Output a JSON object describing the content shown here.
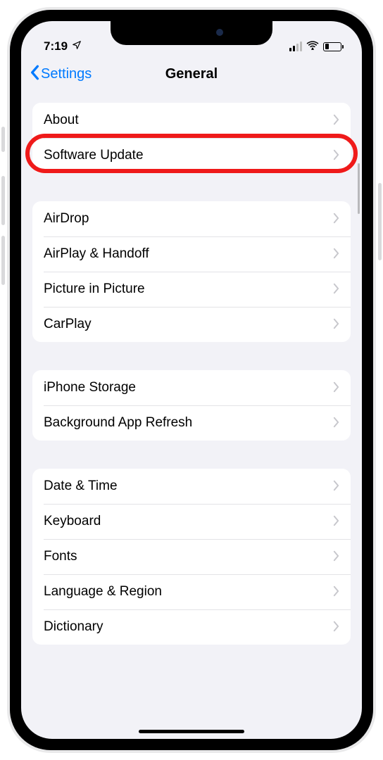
{
  "status": {
    "time": "7:19",
    "location_icon": "location-arrow",
    "signal_bars": 2,
    "wifi": true,
    "battery_pct": 28
  },
  "nav": {
    "back_label": "Settings",
    "title": "General"
  },
  "groups": [
    {
      "id": "g1",
      "rows": [
        {
          "id": "about",
          "label": "About"
        },
        {
          "id": "software-update",
          "label": "Software Update",
          "highlight": true
        }
      ]
    },
    {
      "id": "g2",
      "rows": [
        {
          "id": "airdrop",
          "label": "AirDrop"
        },
        {
          "id": "airplay",
          "label": "AirPlay & Handoff"
        },
        {
          "id": "pip",
          "label": "Picture in Picture"
        },
        {
          "id": "carplay",
          "label": "CarPlay"
        }
      ]
    },
    {
      "id": "g3",
      "rows": [
        {
          "id": "storage",
          "label": "iPhone Storage"
        },
        {
          "id": "bg-refresh",
          "label": "Background App Refresh"
        }
      ]
    },
    {
      "id": "g4",
      "rows": [
        {
          "id": "date-time",
          "label": "Date & Time"
        },
        {
          "id": "keyboard",
          "label": "Keyboard"
        },
        {
          "id": "fonts",
          "label": "Fonts"
        },
        {
          "id": "lang-region",
          "label": "Language & Region"
        },
        {
          "id": "dictionary",
          "label": "Dictionary"
        }
      ]
    }
  ]
}
